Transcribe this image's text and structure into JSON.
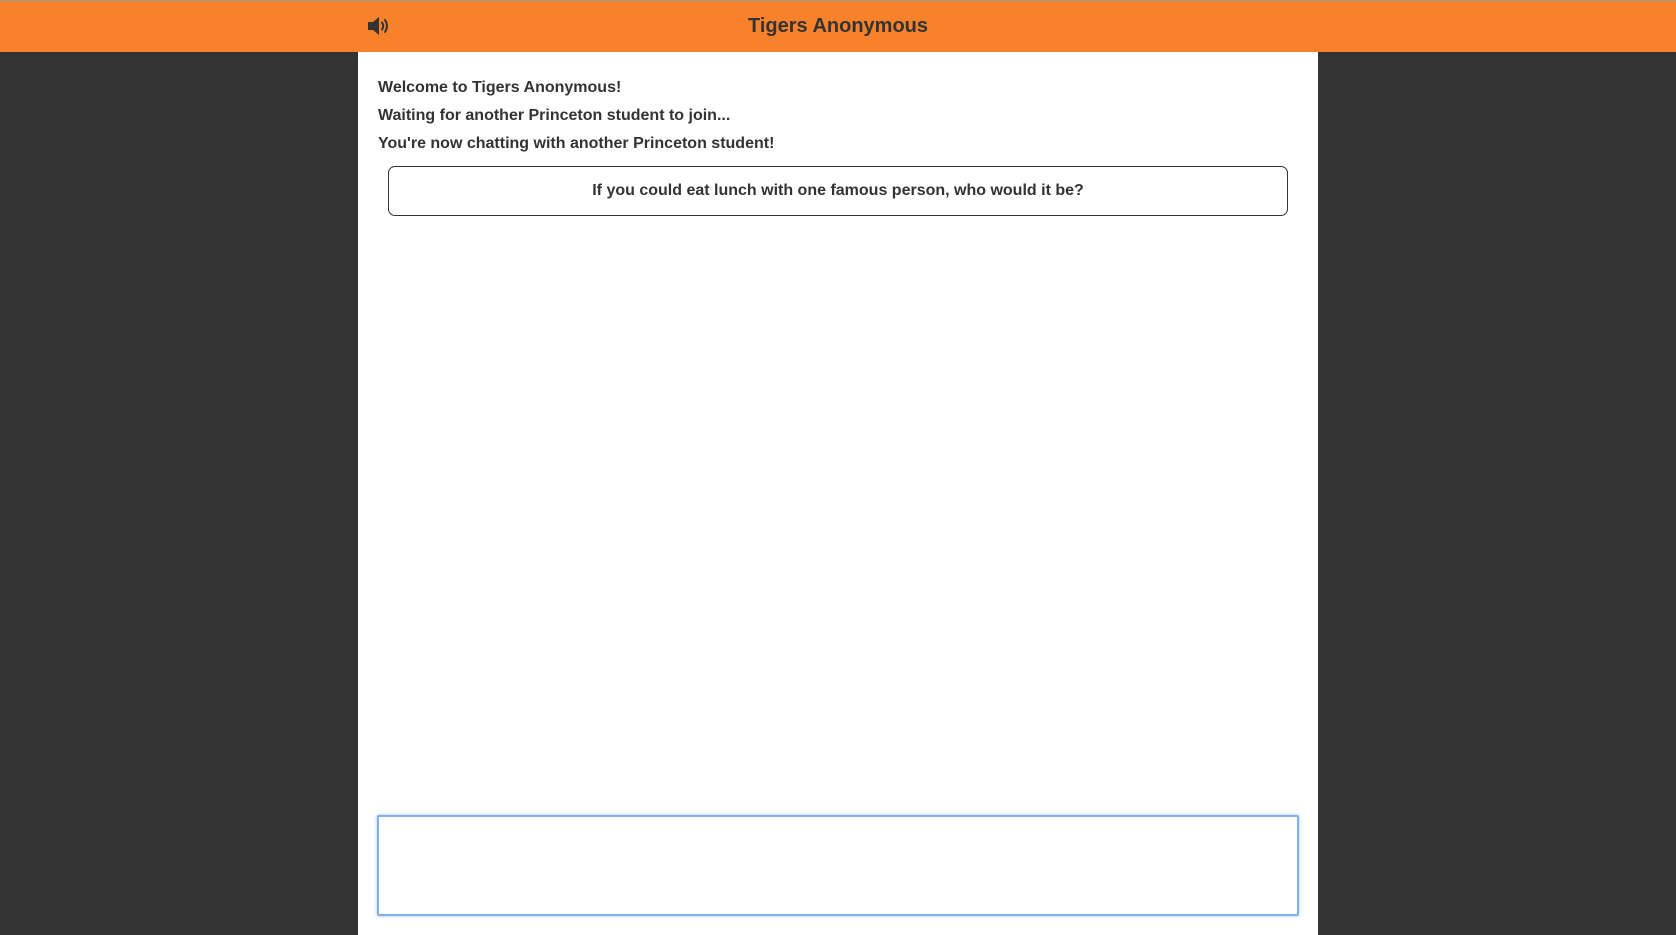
{
  "header": {
    "title": "Tigers Anonymous",
    "sound_icon": "speaker-volume-icon"
  },
  "chat": {
    "status_messages": [
      "Welcome to Tigers Anonymous!",
      "Waiting for another Princeton student to join...",
      "You're now chatting with another Princeton student!"
    ],
    "prompt": "If you could eat lunch with one famous person, who would it be?",
    "input": {
      "value": "",
      "placeholder": ""
    }
  },
  "colors": {
    "header_bg": "#f7822b",
    "page_bg": "#333333",
    "panel_bg": "#ffffff",
    "text": "#333333",
    "input_focus": "#7db1e8"
  }
}
